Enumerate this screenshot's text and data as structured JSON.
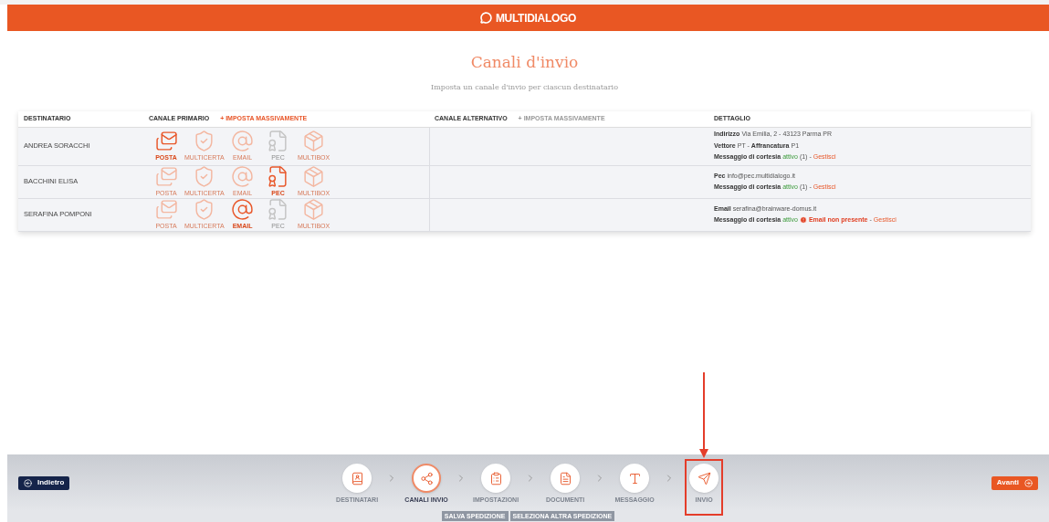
{
  "header": {
    "logo": "MULTIDIALOGO"
  },
  "page": {
    "title": "Canali d'invio",
    "subtitle": "Imposta un canale d'invio per ciascun destinatario"
  },
  "table": {
    "columns": {
      "recipient": "DESTINATARIO",
      "primary": "CANALE PRIMARIO",
      "primary_bulk": "+ IMPOSTA MASSIVAMENTE",
      "alternative": "CANALE ALTERNATIVO",
      "alternative_bulk": "+ IMPOSTA MASSIVAMENTE",
      "detail": "DETTAGLIO"
    },
    "rows": [
      {
        "recipient": "ANDREA SORACCHI",
        "channels": [
          {
            "kind": "posta",
            "label": "POSTA",
            "selected": true,
            "available": true
          },
          {
            "kind": "multicerta",
            "label": "MULTICERTA",
            "selected": false,
            "available": true
          },
          {
            "kind": "email",
            "label": "EMAIL",
            "selected": false,
            "available": true
          },
          {
            "kind": "pec",
            "label": "PEC",
            "selected": false,
            "available": false
          },
          {
            "kind": "multibox",
            "label": "MULTIBOX",
            "selected": false,
            "available": true
          }
        ],
        "detail": [
          [
            {
              "kind": "label",
              "text": "Indirizzo"
            },
            {
              "kind": "text",
              "text": "Via Emilia, 2 - 43123 Parma PR"
            }
          ],
          [
            {
              "kind": "label",
              "text": "Vettore"
            },
            {
              "kind": "text",
              "text": "PT -"
            },
            {
              "kind": "label",
              "text": "Affrancatura"
            },
            {
              "kind": "text",
              "text": "P1"
            }
          ],
          [
            {
              "kind": "label",
              "text": "Messaggio di cortesia"
            },
            {
              "kind": "status",
              "text": "attivo"
            },
            {
              "kind": "text",
              "text": "(1) -"
            },
            {
              "kind": "link",
              "text": "Gestisci"
            }
          ]
        ]
      },
      {
        "recipient": "BACCHINI ELISA",
        "channels": [
          {
            "kind": "posta",
            "label": "POSTA",
            "selected": false,
            "available": true
          },
          {
            "kind": "multicerta",
            "label": "MULTICERTA",
            "selected": false,
            "available": true
          },
          {
            "kind": "email",
            "label": "EMAIL",
            "selected": false,
            "available": true
          },
          {
            "kind": "pec",
            "label": "PEC",
            "selected": true,
            "available": true
          },
          {
            "kind": "multibox",
            "label": "MULTIBOX",
            "selected": false,
            "available": true
          }
        ],
        "detail": [
          [
            {
              "kind": "label",
              "text": "Pec"
            },
            {
              "kind": "text",
              "text": "info@pec.multidialogo.it"
            }
          ],
          [
            {
              "kind": "label",
              "text": "Messaggio di cortesia"
            },
            {
              "kind": "status",
              "text": "attivo"
            },
            {
              "kind": "text",
              "text": "(1) -"
            },
            {
              "kind": "link",
              "text": "Gestisci"
            }
          ]
        ]
      },
      {
        "recipient": "SERAFINA POMPONI",
        "channels": [
          {
            "kind": "posta",
            "label": "POSTA",
            "selected": false,
            "available": true
          },
          {
            "kind": "multicerta",
            "label": "MULTICERTA",
            "selected": false,
            "available": true
          },
          {
            "kind": "email",
            "label": "EMAIL",
            "selected": true,
            "available": true
          },
          {
            "kind": "pec",
            "label": "PEC",
            "selected": false,
            "available": false
          },
          {
            "kind": "multibox",
            "label": "MULTIBOX",
            "selected": false,
            "available": true
          }
        ],
        "detail": [
          [
            {
              "kind": "label",
              "text": "Email"
            },
            {
              "kind": "text",
              "text": "serafina@brainware-domus.it"
            }
          ],
          [
            {
              "kind": "label",
              "text": "Messaggio di cortesia"
            },
            {
              "kind": "status",
              "text": "attivo"
            },
            {
              "kind": "error",
              "text": "Email non presente"
            },
            {
              "kind": "text",
              "text": "-"
            },
            {
              "kind": "link",
              "text": "Gestisci"
            }
          ]
        ]
      }
    ]
  },
  "footer": {
    "back": "Indietro",
    "next": "Avanti",
    "steps": [
      {
        "kind": "recipients",
        "label": "DESTINATARI",
        "selected": false,
        "highlighted": false
      },
      {
        "kind": "channels",
        "label": "CANALI INVIO",
        "selected": true,
        "highlighted": false
      },
      {
        "kind": "settings",
        "label": "IMPOSTAZIONI",
        "selected": false,
        "highlighted": false
      },
      {
        "kind": "documents",
        "label": "DOCUMENTI",
        "selected": false,
        "highlighted": false
      },
      {
        "kind": "message",
        "label": "MESSAGGIO",
        "selected": false,
        "highlighted": false
      },
      {
        "kind": "send",
        "label": "INVIO",
        "selected": false,
        "highlighted": true
      }
    ],
    "actions": [
      "SALVA SPEDIZIONE",
      "SELEZIONA ALTRA SPEDIZIONE"
    ]
  }
}
